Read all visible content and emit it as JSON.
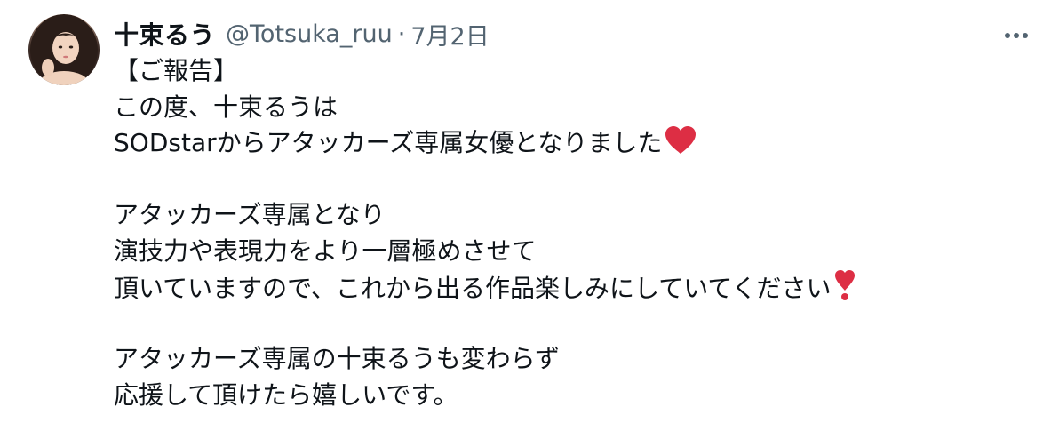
{
  "author": {
    "display_name": "十束るう",
    "handle": "@Totsuka_ruu",
    "separator": "·",
    "date": "7月2日",
    "avatar_icon": "profile-photo"
  },
  "more_icon": "more-horizontal-icon",
  "tweet": {
    "lines": [
      "【ご報告】",
      "この度、十束るうは",
      "SODstarからアタッカーズ専属女優となりました",
      "",
      "アタッカーズ専属となり",
      "演技力や表現力をより一層極めさせて",
      "頂いていますので、これから出る作品楽しみにしていてください",
      "",
      "アタッカーズ専属の十束るうも変わらず",
      "応援して頂けたら嬉しいです。"
    ],
    "emojis": {
      "line3": "red-heart-emoji",
      "line7": "heavy-exclamation-heart-emoji"
    }
  },
  "colors": {
    "text": "#0f1419",
    "secondary": "#536471",
    "heart": "#e0245e"
  }
}
